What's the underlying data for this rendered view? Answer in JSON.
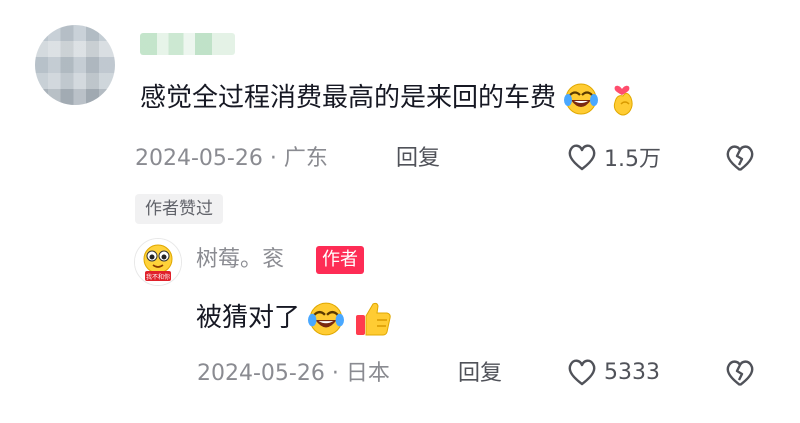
{
  "comment": {
    "username": "",
    "text": "感觉全过程消费最高的是来回的车费",
    "emojis": [
      "laughing-crying-emoji",
      "finger-heart-emoji"
    ],
    "date": "2024-05-26",
    "separator": "·",
    "location": "广东",
    "reply_label": "回复",
    "like_count": "1.5万",
    "author_liked_badge": "作者赞过"
  },
  "reply": {
    "username": "树莓。衮",
    "author_tag": "作者",
    "avatar_caption": "我不和你",
    "text": "被猜对了",
    "emojis": [
      "laughing-crying-emoji",
      "thumbs-up-emoji"
    ],
    "date": "2024-05-26",
    "separator": "·",
    "location": "日本",
    "reply_label": "回复",
    "like_count": "5333"
  },
  "colors": {
    "text_primary": "#161823",
    "text_secondary": "#8a8b91",
    "author_tag": "#fe2c55",
    "badge_bg": "#f1f1f2"
  },
  "icons": [
    "heart-outline-icon",
    "broken-heart-icon"
  ]
}
